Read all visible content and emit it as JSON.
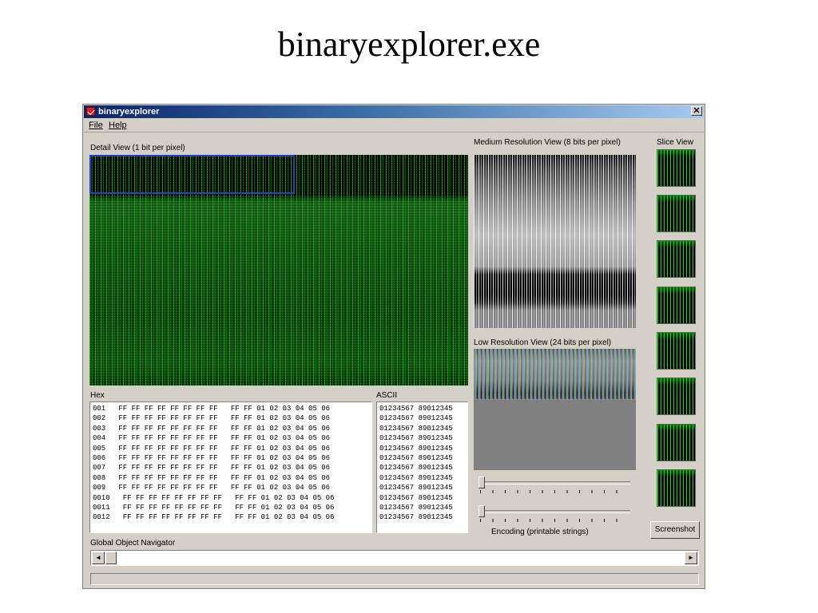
{
  "slide": {
    "title": "binaryexplorer.exe"
  },
  "window": {
    "title": "binaryexplorer",
    "close_glyph": "✕"
  },
  "menu": [
    {
      "label": "File"
    },
    {
      "label": "Help"
    }
  ],
  "detail_view": {
    "label": "Detail View (1 bit per pixel)"
  },
  "hex": {
    "label": "Hex",
    "rows": [
      "001   FF FF FF FF FF FF FF FF   FF FF 01 02 03 04 05 06",
      "002   FF FF FF FF FF FF FF FF   FF FF 01 02 03 04 05 06",
      "003   FF FF FF FF FF FF FF FF   FF FF 01 02 03 04 05 06",
      "004   FF FF FF FF FF FF FF FF   FF FF 01 02 03 04 05 06",
      "005   FF FF FF FF FF FF FF FF   FF FF 01 02 03 04 05 06",
      "006   FF FF FF FF FF FF FF FF   FF FF 01 02 03 04 05 06",
      "007   FF FF FF FF FF FF FF FF   FF FF 01 02 03 04 05 06",
      "008   FF FF FF FF FF FF FF FF   FF FF 01 02 03 04 05 06",
      "009   FF FF FF FF FF FF FF FF   FF FF 01 02 03 04 05 06",
      "0010   FF FF FF FF FF FF FF FF   FF FF 01 02 03 04 05 06",
      "0011   FF FF FF FF FF FF FF FF   FF FF 01 02 03 04 05 06",
      "0012   FF FF FF FF FF FF FF FF   FF FF 01 02 03 04 05 06"
    ]
  },
  "ascii": {
    "label": "ASCII",
    "rows": [
      "01234567 89012345",
      "01234567 89012345",
      "01234567 89012345",
      "01234567 89012345",
      "01234567 89012345",
      "01234567 89012345",
      "01234567 89012345",
      "01234567 89012345",
      "01234567 89012345",
      "01234567 89012345",
      "01234567 89012345",
      "01234567 89012345"
    ]
  },
  "medium_view": {
    "label": "Medium Resolution View (8 bits per pixel)"
  },
  "low_view": {
    "label": "Low Resolution View (24 bits per pixel)"
  },
  "sliders": {
    "encoding_label": "Encoding (printable strings)",
    "slider1_value": 0,
    "slider2_value": 0
  },
  "slice_view": {
    "label": "Slice View",
    "count": 8
  },
  "screenshot_button": {
    "label": "Screenshot"
  },
  "navigator": {
    "label": "Global Object Navigator",
    "left_arrow": "◄",
    "right_arrow": "►"
  },
  "colors": {
    "titlebar_start": "#0a246a",
    "titlebar_end": "#a6caf0",
    "window_bg": "#d4d0c8",
    "bitmap_green": "#00ff00",
    "selection_blue": "#1f3fd0"
  }
}
